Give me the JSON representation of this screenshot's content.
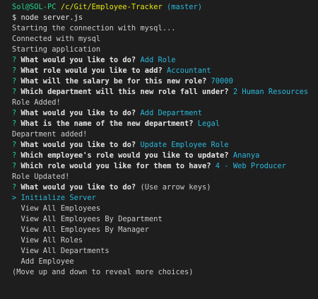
{
  "prompt": {
    "user_host": "Sol@SOL-PC",
    "path": "/c/Git/Employee-Tracker",
    "branch": "(master)",
    "symbol": "$",
    "command": "node server.js"
  },
  "output": {
    "starting": "Starting the connection with mysql...",
    "connected": "Connected with mysql",
    "app_start": "Starting application"
  },
  "qmark": "?",
  "questions": {
    "q1": {
      "text": "What would you like to do?",
      "answer": "Add Role"
    },
    "q2": {
      "text": "What role would you like to add?",
      "answer": "Accountant"
    },
    "q3": {
      "text": "What will the salary be for this new role?",
      "answer": "70000"
    },
    "q4": {
      "text": "Which department will this new role fall under?",
      "answer": "2 Human Resources"
    },
    "msg1": "Role Added!",
    "q5": {
      "text": "What would you like to do?",
      "answer": "Add Department"
    },
    "q6": {
      "text": "What is the name of the new department?",
      "answer": "Legal"
    },
    "msg2": "Department added!",
    "q7": {
      "text": "What would you like to do?",
      "answer": "Update Employee Role"
    },
    "q8": {
      "text": "Which employee's role would you like to update?",
      "answer": "Ananya"
    },
    "q9": {
      "text": "Which role would you like for them to have?",
      "answer": "4 - Web Producer"
    },
    "msg3": "Role Updated!",
    "q10": {
      "text": "What would you like to do?",
      "hint": "(Use arrow keys)"
    }
  },
  "menu": {
    "pointer": ">",
    "selected": "Initialize Server",
    "items": [
      "View All Employees",
      "View All Employees By Department",
      "View All Employees By Manager",
      "View All Roles",
      "View All Departments",
      "Add Employee"
    ],
    "footer": "(Move up and down to reveal more choices)"
  }
}
